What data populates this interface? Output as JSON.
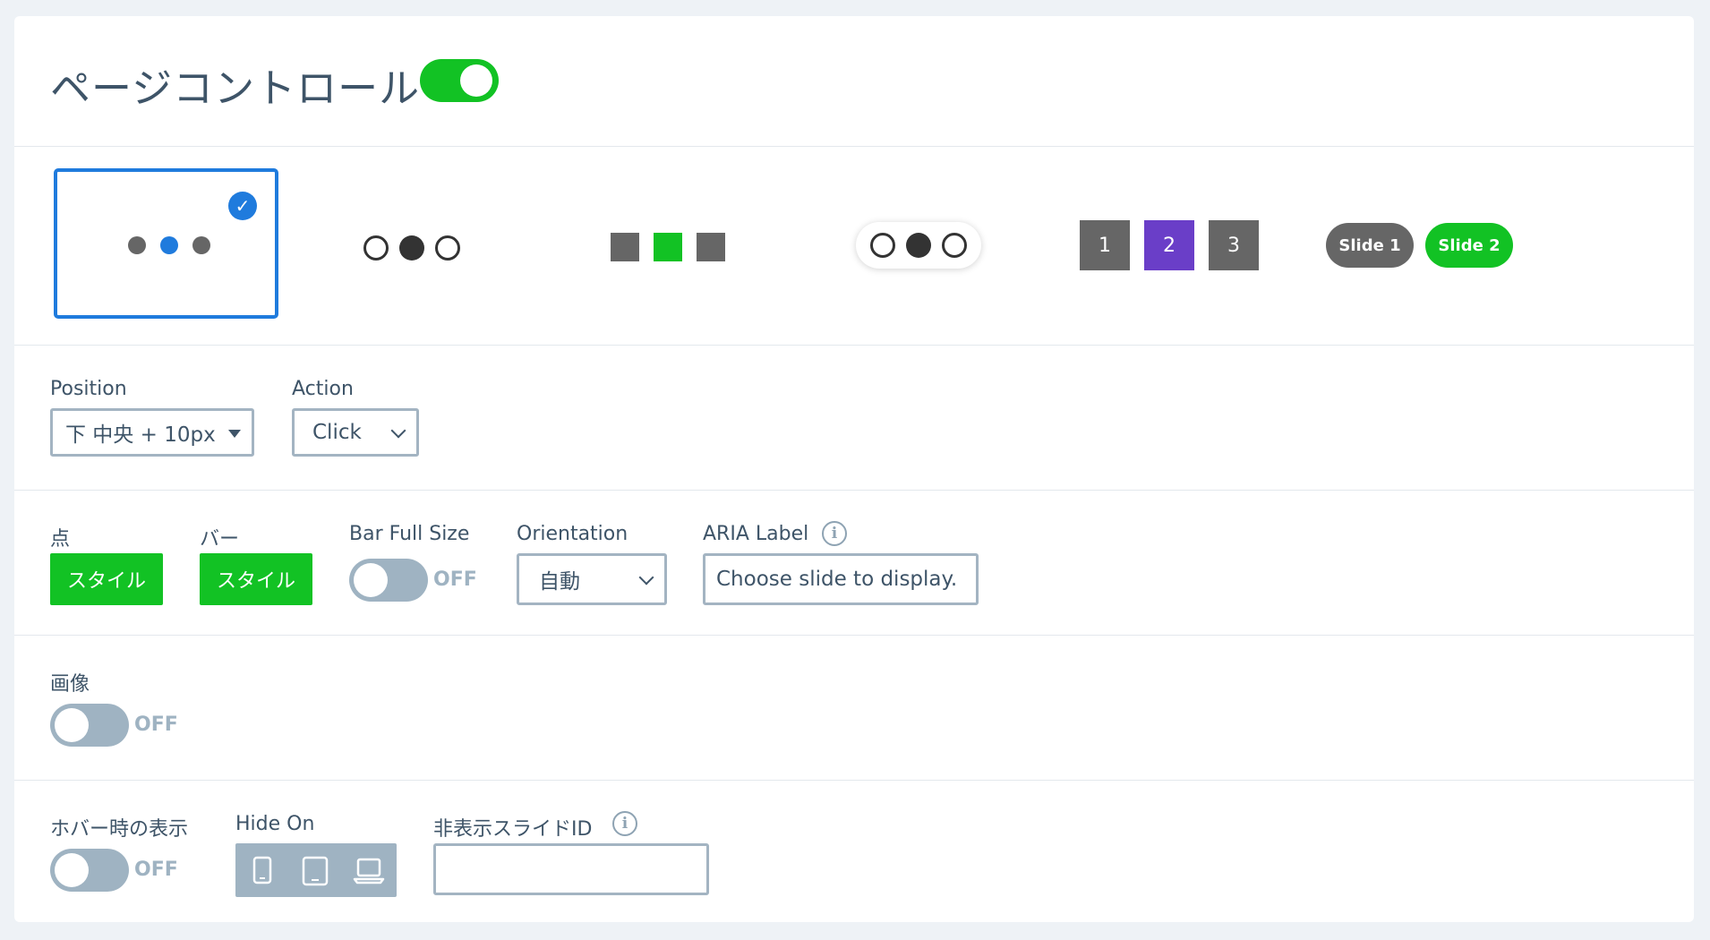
{
  "header": {
    "title": "ページコントロール",
    "enabled": true
  },
  "styles": {
    "selected_index": 0,
    "numbers": [
      "1",
      "2",
      "3"
    ],
    "pills": [
      "Slide 1",
      "Slide 2"
    ],
    "colors": {
      "accent": "#1f7bdd",
      "green": "#12c224",
      "purple": "#6a3ec8",
      "grey": "#666666"
    }
  },
  "row1": {
    "position_label": "Position",
    "position_value": "下 中央 + 10px",
    "action_label": "Action",
    "action_value": "Click"
  },
  "row2": {
    "dot_label": "点",
    "dot_button": "スタイル",
    "bar_label": "バー",
    "bar_button": "スタイル",
    "barfull_label": "Bar Full Size",
    "barfull_state": "OFF",
    "orientation_label": "Orientation",
    "orientation_value": "自動",
    "aria_label": "ARIA Label",
    "aria_value": "Choose slide to display."
  },
  "row3": {
    "image_label": "画像",
    "image_state": "OFF"
  },
  "row4": {
    "hover_label": "ホバー時の表示",
    "hover_state": "OFF",
    "hideon_label": "Hide On",
    "hide_ids_label": "非表示スライドID",
    "hide_ids_value": ""
  }
}
